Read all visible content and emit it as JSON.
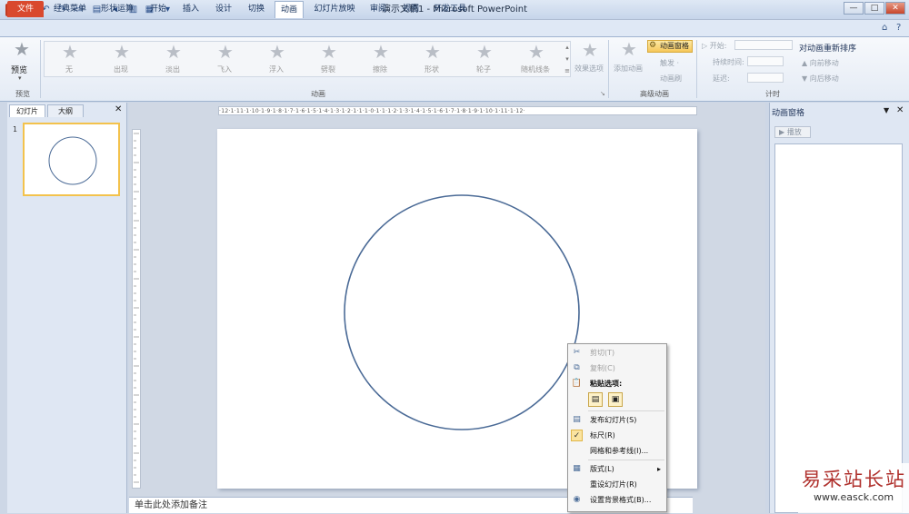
{
  "app": {
    "icon_letter": "P",
    "title": "演示文稿1 - Microsoft PowerPoint"
  },
  "window_controls": {
    "minimize": "—",
    "maximize": "□",
    "close": "✕"
  },
  "ribbon_tabs": [
    "文件",
    "经典菜单",
    "形状运算",
    "开始",
    "插入",
    "设计",
    "切换",
    "动画",
    "幻灯片放映",
    "审阅",
    "视图",
    "开发工具"
  ],
  "active_tab": "动画",
  "ribbon": {
    "preview": {
      "label": "预览",
      "group": "预览"
    },
    "animation_gallery": [
      "无",
      "出现",
      "淡出",
      "飞入",
      "浮入",
      "劈裂",
      "擦除",
      "形状",
      "轮子",
      "随机线条"
    ],
    "effect_options": "效果选项",
    "animation_group": "动画",
    "add_animation": "添加动画",
    "animation_pane_btn": "动画窗格",
    "trigger": "触发 ·",
    "animation_painter": "动画刷",
    "advanced_group": "高级动画",
    "start_label": "▷ 开始:",
    "duration_label": "持续时间:",
    "delay_label": "延迟:",
    "timing_group": "计时",
    "reorder_title": "对动画重新排序",
    "move_earlier": "▲ 向前移动",
    "move_later": "▼ 向后移动"
  },
  "left_panel": {
    "tab_slides": "幻灯片",
    "tab_outline": "大纲",
    "close": "✕",
    "slide_number": "1"
  },
  "ruler_text": "·12·1·11·1·10·1·9·1·8·1·7·1·6·1·5·1·4·1·3·1·2·1·1·1·0·1·1·1·2·1·3·1·4·1·5·1·6·1·7·1·8·1·9·1·10·1·11·1·12·",
  "notes_placeholder": "单击此处添加备注",
  "right_pane": {
    "title": "动画窗格",
    "play": "▶ 播放",
    "dropdown": "▼",
    "close": "✕"
  },
  "context_menu": {
    "items": [
      {
        "label": "剪切(T)",
        "icon": "✂",
        "disabled": true
      },
      {
        "label": "复制(C)",
        "icon": "⧉",
        "disabled": true
      },
      {
        "label": "粘贴选项:",
        "icon": "📋",
        "disabled": false,
        "bold": true
      },
      {
        "label": "发布幻灯片(S)",
        "icon": "▤",
        "disabled": false
      },
      {
        "label": "标尺(R)",
        "icon": "✓",
        "disabled": false
      },
      {
        "label": "网格和参考线(I)...",
        "icon": "",
        "disabled": false
      },
      {
        "label": "版式(L)",
        "icon": "▦",
        "disabled": false,
        "arrow": "▸"
      },
      {
        "label": "重设幻灯片(R)",
        "icon": "",
        "disabled": false
      },
      {
        "label": "设置背景格式(B)...",
        "icon": "◉",
        "disabled": false
      }
    ]
  },
  "watermark": {
    "title": "易采站长站",
    "url": "www.easck.com"
  },
  "colors": {
    "accent": "#d9492e",
    "selected": "#f3c24c",
    "circle": "#4a6a96"
  }
}
